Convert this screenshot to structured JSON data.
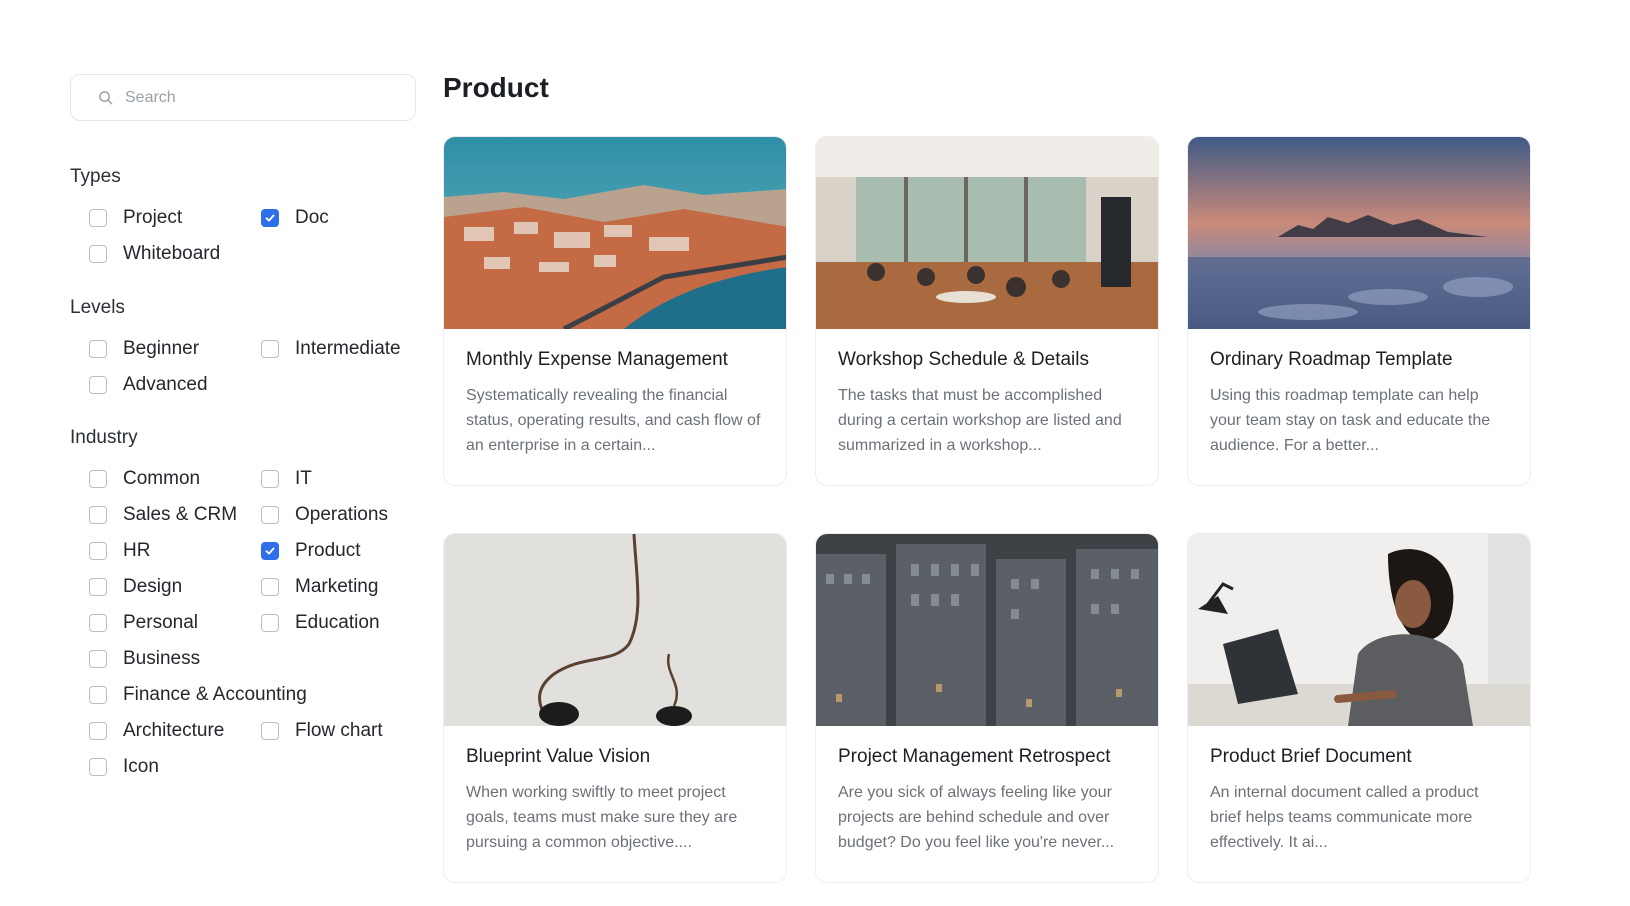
{
  "search": {
    "placeholder": "Search",
    "icon": "search-icon"
  },
  "filters": {
    "types": {
      "title": "Types",
      "options": [
        {
          "label": "Project",
          "checked": false
        },
        {
          "label": "Doc",
          "checked": true
        },
        {
          "label": "Whiteboard",
          "checked": false
        }
      ]
    },
    "levels": {
      "title": "Levels",
      "options": [
        {
          "label": "Beginner",
          "checked": false
        },
        {
          "label": "Intermediate",
          "checked": false
        },
        {
          "label": "Advanced",
          "checked": false
        }
      ]
    },
    "industry": {
      "title": "Industry",
      "options": [
        {
          "label": "Common",
          "checked": false
        },
        {
          "label": "IT",
          "checked": false
        },
        {
          "label": "Sales & CRM",
          "checked": false
        },
        {
          "label": "Operations",
          "checked": false
        },
        {
          "label": "HR",
          "checked": false
        },
        {
          "label": "Product",
          "checked": true
        },
        {
          "label": "Design",
          "checked": false
        },
        {
          "label": "Marketing",
          "checked": false
        },
        {
          "label": "Personal",
          "checked": false
        },
        {
          "label": "Education",
          "checked": false
        },
        {
          "label": "Business",
          "checked": false
        },
        {
          "label": "Finance & Accounting",
          "checked": false
        },
        {
          "label": "Architecture",
          "checked": false
        },
        {
          "label": "Flow chart",
          "checked": false
        },
        {
          "label": "Icon",
          "checked": false
        }
      ]
    }
  },
  "main": {
    "title": "Product",
    "cards": [
      {
        "title": "Monthly Expense Management",
        "description": "Systematically revealing the financial status, operating results, and cash flow of an enterprise in a certain...",
        "image": "coastal-city-aerial"
      },
      {
        "title": "Workshop Schedule & Details",
        "description": "The tasks that must be accomplished during a certain workshop are listed and summarized in a workshop...",
        "image": "workshop-room"
      },
      {
        "title": "Ordinary Roadmap Template",
        "description": "Using this roadmap template can help your team stay on task and educate the audience. For a better...",
        "image": "misty-sunset-landscape"
      },
      {
        "title": "Blueprint Value Vision",
        "description": "When working swiftly to meet project goals, teams must make sure they are pursuing a common objective....",
        "image": "earphones-cable"
      },
      {
        "title": "Project Management Retrospect",
        "description": "Are you sick of always feeling like your projects are behind schedule and over budget? Do you feel like you're never...",
        "image": "city-buildings-aerial"
      },
      {
        "title": "Product Brief Document",
        "description": "An internal document called a product brief helps teams communicate more effectively. It ai...",
        "image": "woman-at-laptop"
      }
    ]
  },
  "colors": {
    "accent": "#2f6fea",
    "checkbox_border": "#b9bdc4",
    "description": "#6b7079"
  }
}
